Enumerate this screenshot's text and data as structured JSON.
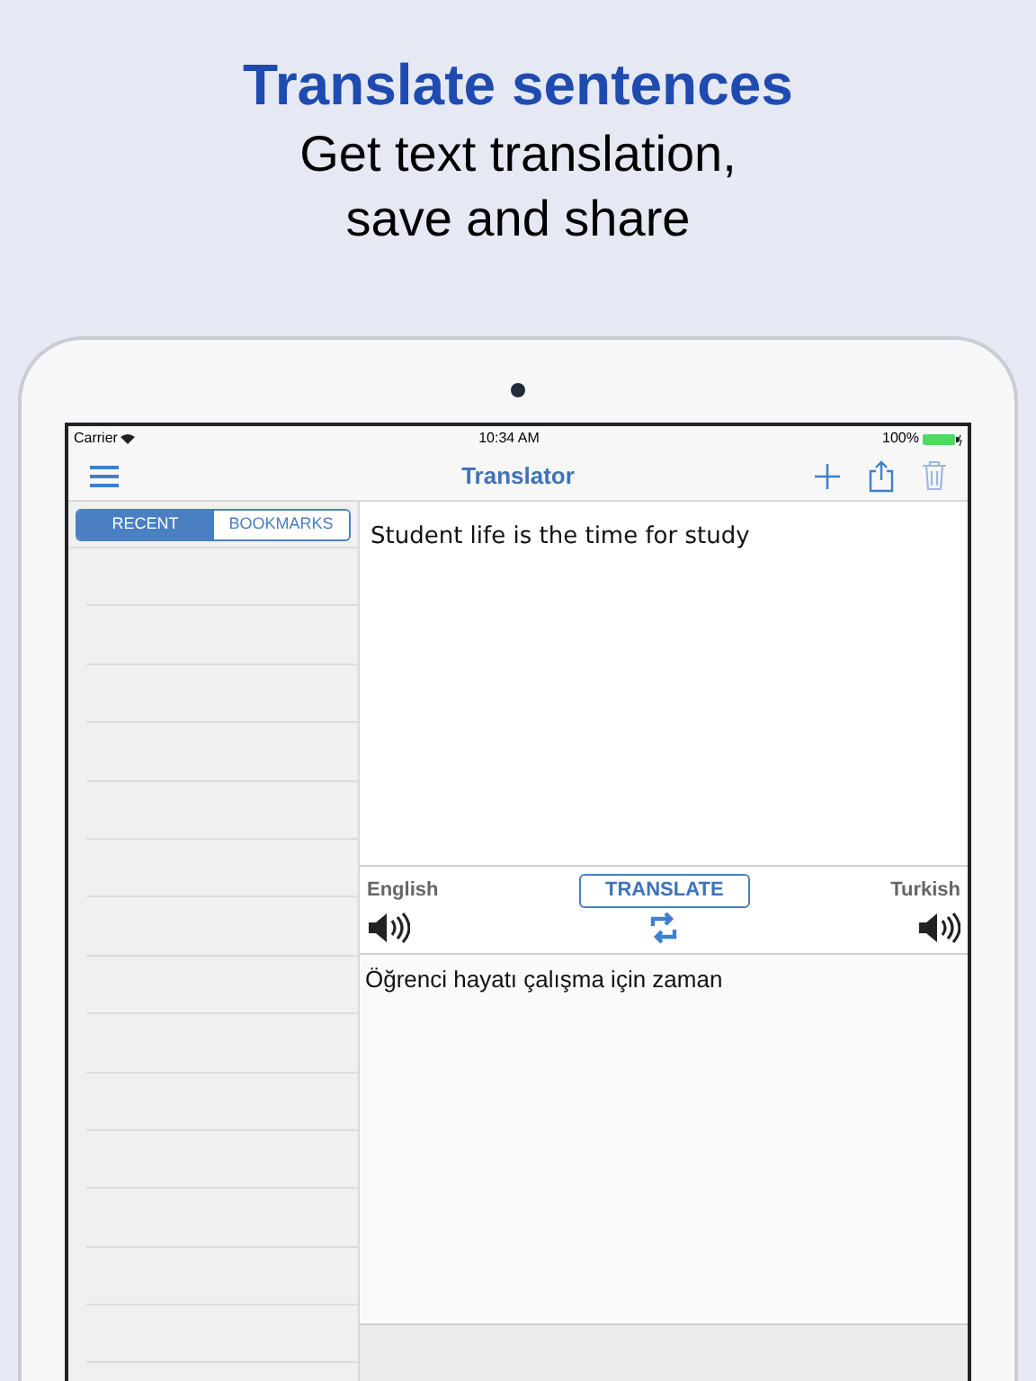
{
  "headline": {
    "title": "Translate sentences",
    "subtitle_lines": [
      "Get text translation,",
      "save and share"
    ]
  },
  "status_bar": {
    "carrier": "Carrier",
    "time": "10:34 AM",
    "battery": "100%"
  },
  "nav_bar": {
    "title": "Translator"
  },
  "segments": [
    {
      "label": "RECENT",
      "selected": true
    },
    {
      "label": "BOOKMARKS",
      "selected": false
    }
  ],
  "source_text": "Student life is the time for study",
  "controls": {
    "source_language": "English",
    "target_language": "Turkish",
    "translate": "TRANSLATE"
  },
  "translation_text": "Öğrenci hayatı çalışma için zaman"
}
